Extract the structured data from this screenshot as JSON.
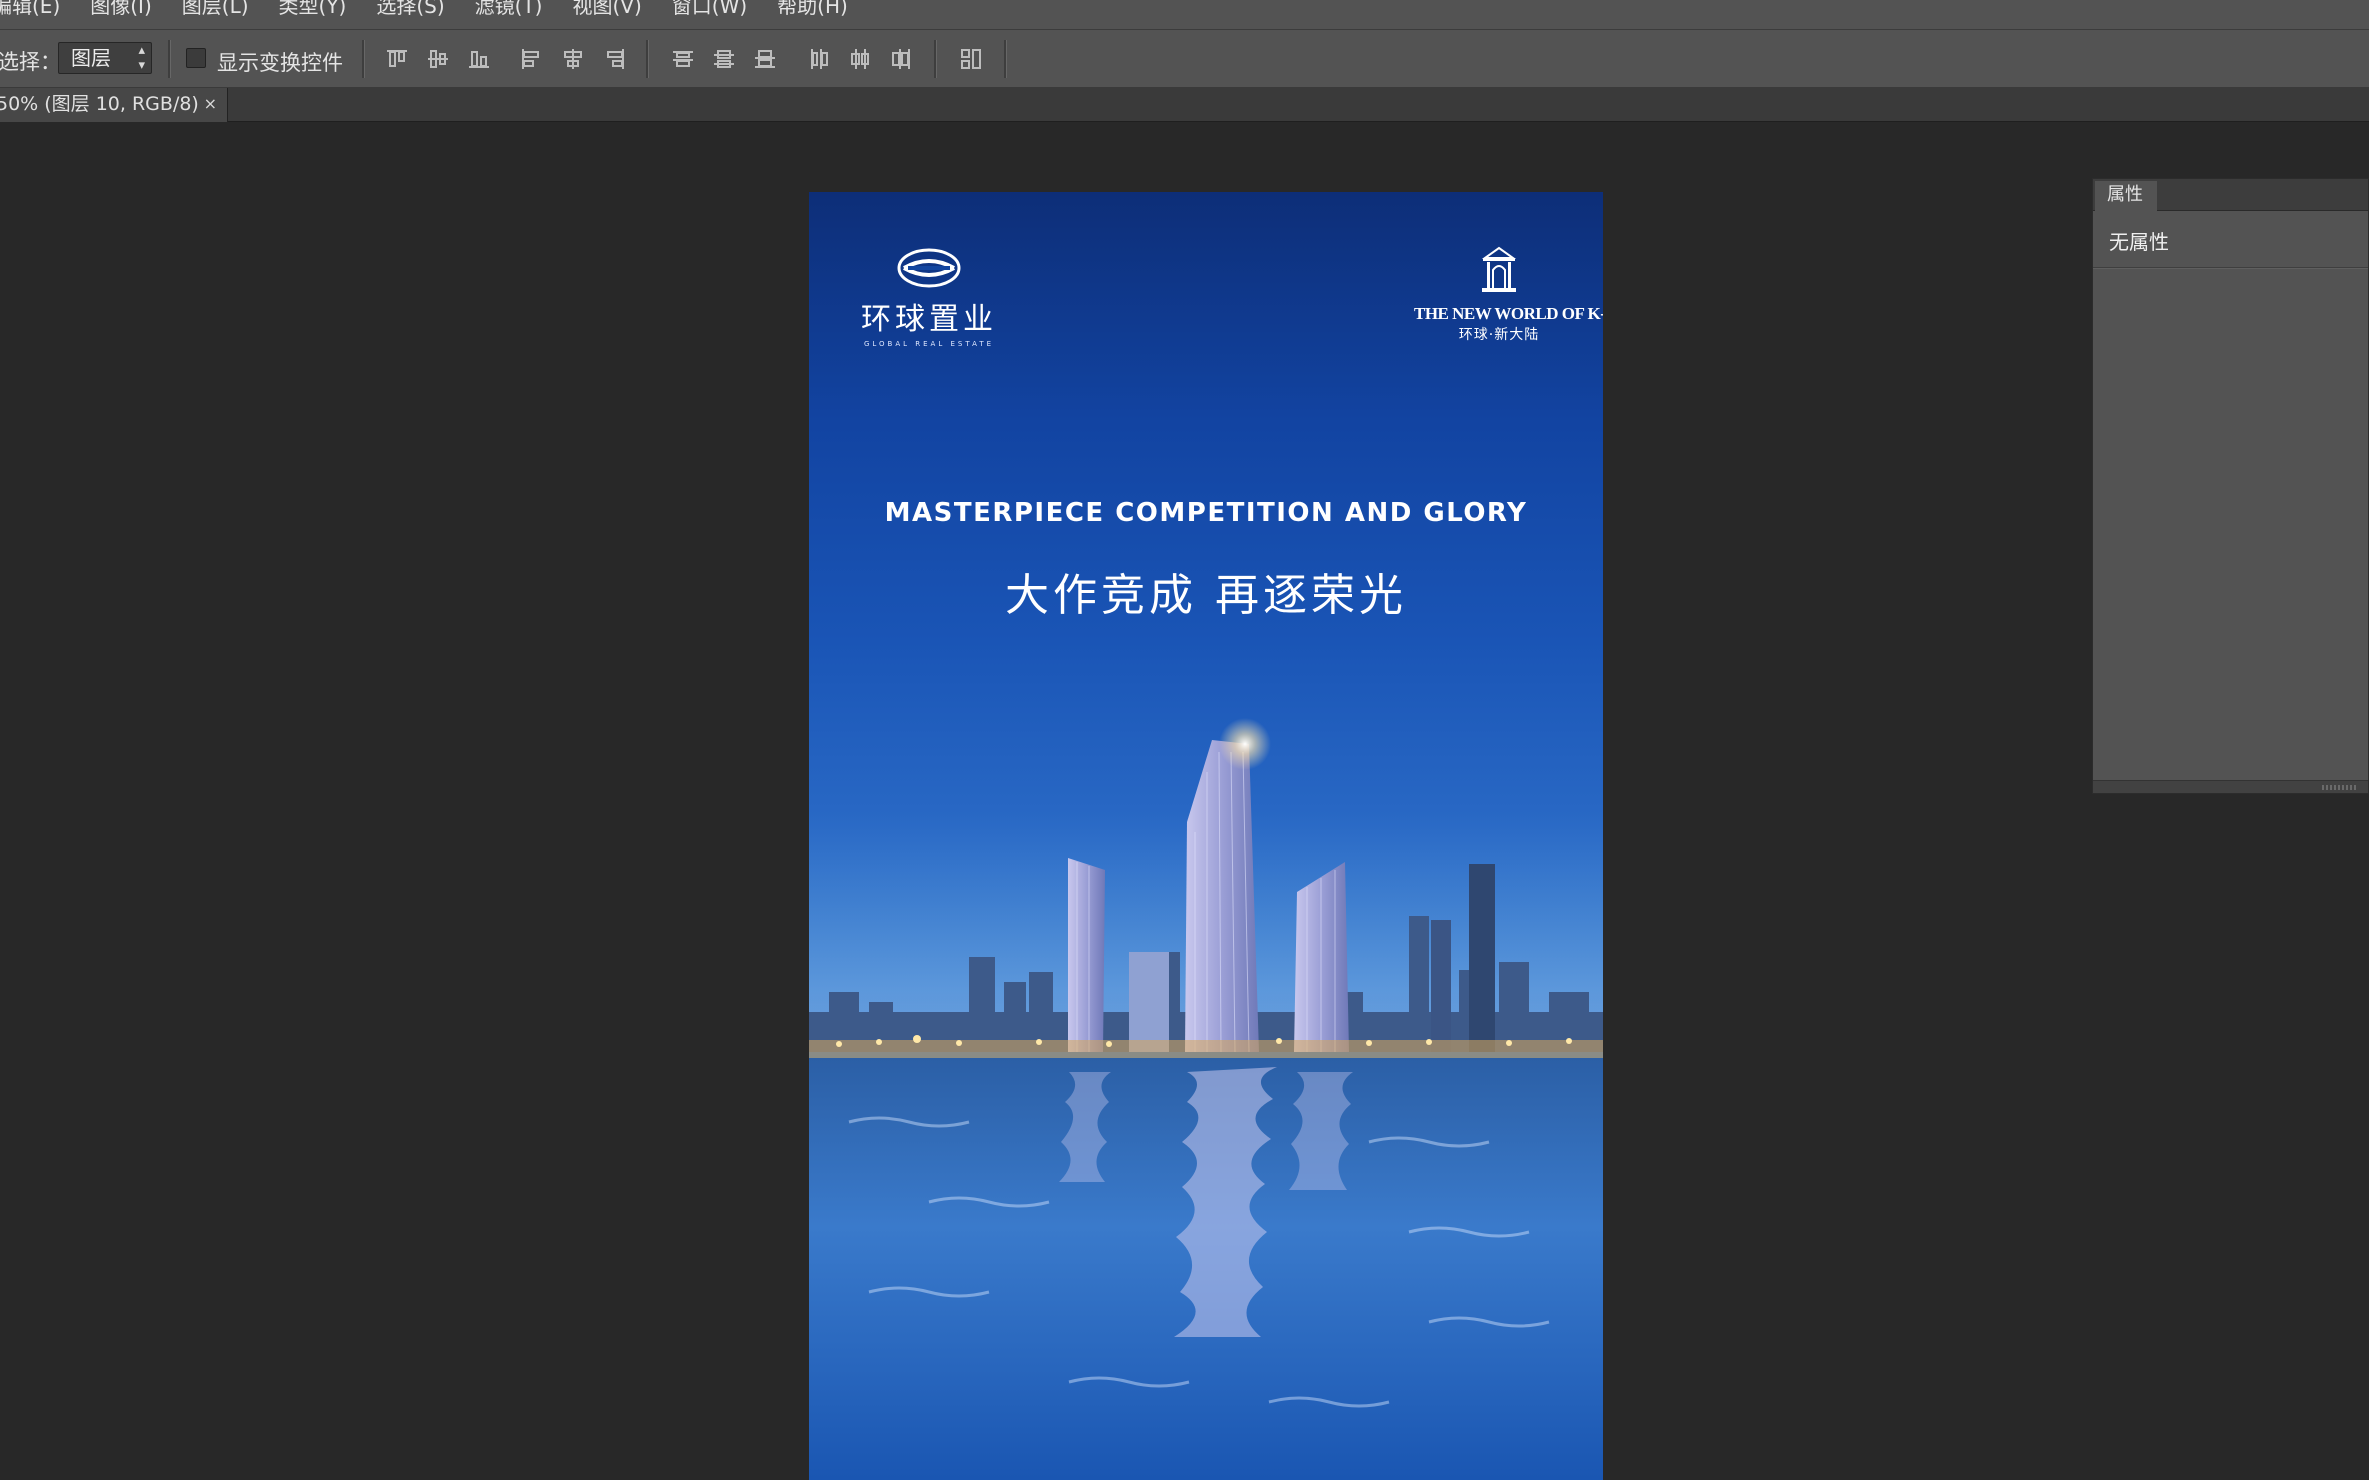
{
  "menu": {
    "items": [
      "编辑(E)",
      "图像(I)",
      "图层(L)",
      "类型(Y)",
      "选择(S)",
      "滤镜(T)",
      "视图(V)",
      "窗口(W)",
      "帮助(H)"
    ]
  },
  "options_bar": {
    "select_label": "选择：",
    "select_value": "图层",
    "show_transform_label": "显示变换控件",
    "show_transform_checked": false
  },
  "document_tab": {
    "title": "50% (图层 10, RGB/8)",
    "close": "×"
  },
  "poster": {
    "logo_left_cn": "环球置业",
    "logo_left_en": "GLOBAL REAL ESTATE",
    "logo_right_en": "THE NEW WORLD OF K-LAND",
    "logo_right_cn": "环球·新大陆",
    "headline_en": "MASTERPIECE COMPETITION AND GLORY",
    "headline_cn": "大作竞成 再逐荣光"
  },
  "properties_panel": {
    "tab_label": "属性",
    "body_text": "无属性"
  },
  "colors": {
    "ui_dark": "#282828",
    "ui_panel": "#535353",
    "poster_top": "#0d2e78",
    "poster_mid": "#2a6ac6"
  }
}
